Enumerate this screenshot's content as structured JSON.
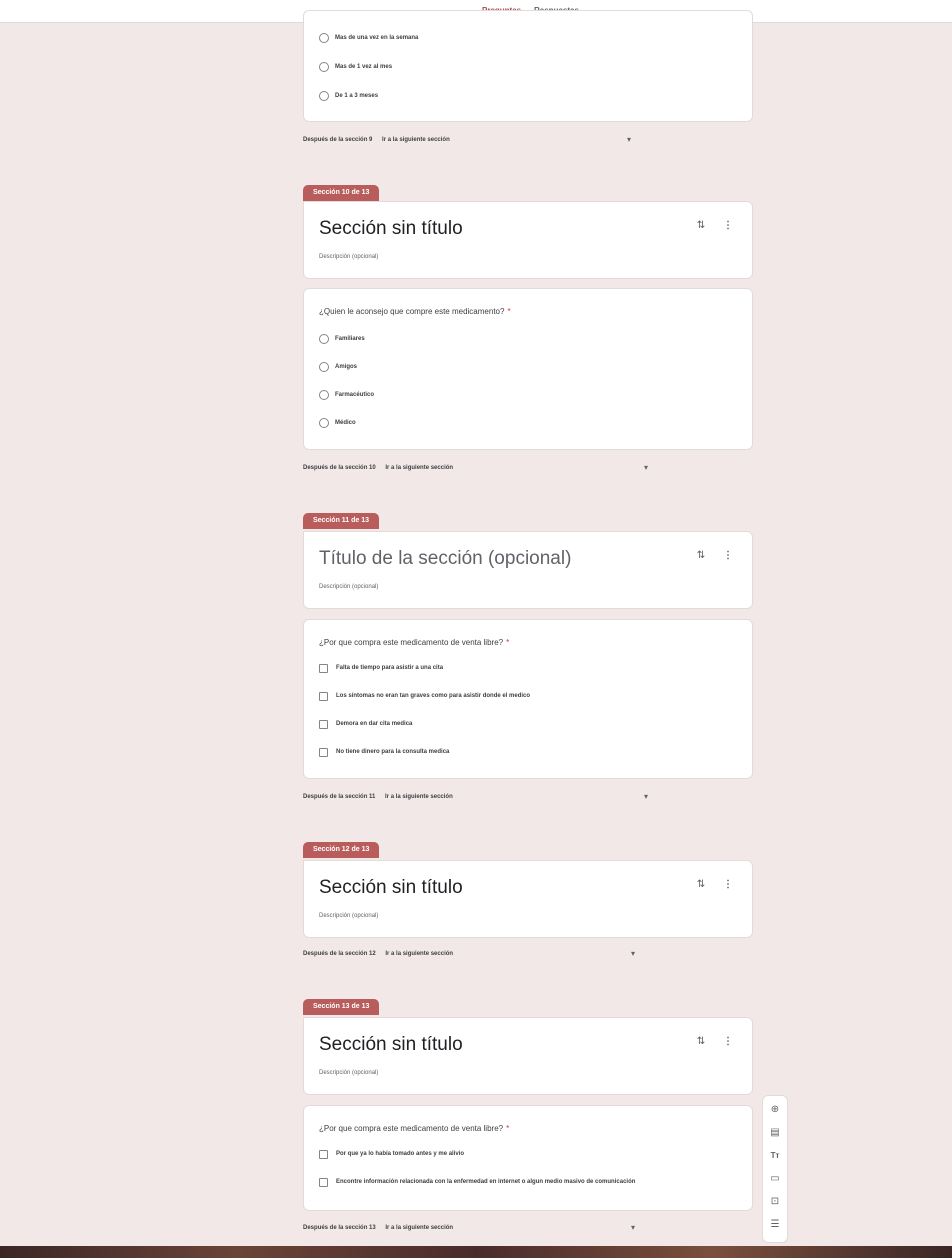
{
  "tabs": {
    "questions": "Preguntas",
    "responses": "Respuestas"
  },
  "section9": {
    "options": [
      "Mas de una vez en la semana",
      "Mas de 1 vez al mes",
      "De 1 a 3 meses"
    ],
    "after": "Después de la sección 9",
    "goto": "Ir a la siguiente sección"
  },
  "section10": {
    "header": "Sección 10 de 13",
    "title": "Sección sin título",
    "desc": "Descripción (opcional)",
    "question": "¿Quien le aconsejo que compre este medicamento?",
    "options": [
      "Familiares",
      "Amigos",
      "Farmacéutico",
      "Médico"
    ],
    "after": "Después de la sección 10",
    "goto": "Ir a la siguiente sección"
  },
  "section11": {
    "header": "Sección 11 de 13",
    "title": "Título de la sección (opcional)",
    "desc": "Descripción (opcional)",
    "question": "¿Por que compra este medicamento de venta libre?",
    "options": [
      "Falta de tiempo para asistir a una cita",
      "Los síntomas no eran tan graves como para asistir donde el medico",
      "Demora en dar cita medica",
      "No tiene dinero para la consulta medica"
    ],
    "after": "Después de la sección 11",
    "goto": "Ir a la siguiente sección"
  },
  "section12": {
    "header": "Sección 12 de 13",
    "title": "Sección sin título",
    "desc": "Descripción (opcional)",
    "after": "Después de la sección 12",
    "goto": "Ir a la siguiente sección"
  },
  "section13": {
    "header": "Sección 13 de 13",
    "title": "Sección sin título",
    "desc": "Descripción (opcional)",
    "question": "¿Por que compra este medicamento de venta libre?",
    "options": [
      "Por que ya lo había tomado antes y me alivio",
      "Encontre información relacionada con la enfermedad en internet o algun medio masivo de comunicación"
    ],
    "after": "Después de la sección 13",
    "goto": "Ir a la siguiente sección"
  },
  "required_mark": "*",
  "toolbar_icons": [
    "add-question-icon",
    "import-questions-icon",
    "add-title-icon",
    "add-image-icon",
    "add-video-icon",
    "add-section-icon"
  ],
  "colors": {
    "accent": "#b85c5c",
    "background": "#f3e8e8"
  }
}
